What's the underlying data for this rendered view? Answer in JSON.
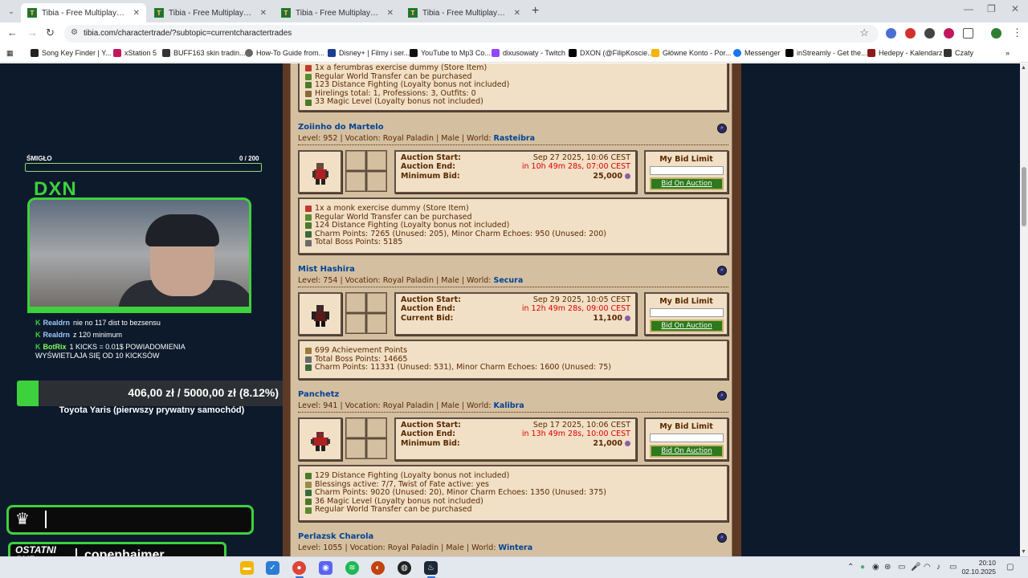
{
  "tabs": [
    {
      "title": "Tibia - Free Multiplayer Online",
      "active": true
    },
    {
      "title": "Tibia - Free Multiplayer Online",
      "active": false
    },
    {
      "title": "Tibia - Free Multiplayer Online",
      "active": false
    },
    {
      "title": "Tibia - Free Multiplayer Online",
      "active": false
    }
  ],
  "browser": {
    "url": "tibia.com/charactertrade/?subtopic=currentcharactertrades",
    "new_tab": "+"
  },
  "bookmarks": [
    {
      "label": "Song Key Finder | Y...",
      "color": "#222"
    },
    {
      "label": "xStation 5",
      "color": "#c2185b"
    },
    {
      "label": "BUFF163 skin tradin...",
      "color": "#333"
    },
    {
      "label": "How-To Guide from...",
      "color": "#666"
    },
    {
      "label": "Disney+ | Filmy i ser...",
      "color": "#1a3d8f"
    },
    {
      "label": "YouTube to Mp3 Co...",
      "color": "#111"
    },
    {
      "label": "dixusowaty - Twitch",
      "color": "#9146ff"
    },
    {
      "label": "DXON (@FilipKoscie...",
      "color": "#000"
    },
    {
      "label": "Główne Konto - Por...",
      "color": "#f4b400"
    },
    {
      "label": "Messenger",
      "color": "#1877f2"
    },
    {
      "label": "inStreamly - Get the...",
      "color": "#000"
    },
    {
      "label": "Hedepy - Kalendarz",
      "color": "#8b1a1a"
    },
    {
      "label": "Czaty",
      "color": "#333"
    }
  ],
  "stream": {
    "smiglo_label": "ŚMIGŁO",
    "smiglo_count": "0 / 200",
    "brand": "DXN",
    "chat": [
      {
        "user": "Realdrn",
        "msg": "nie no 117 dist to bezsensu",
        "style": "u1"
      },
      {
        "user": "Realdrn",
        "msg": "z 120 minimum",
        "style": "u1"
      },
      {
        "user": "BotRix",
        "msg": "1 KICKS = 0.01$ POWIADOMIENIA WYŚWIETLAJA SIĘ OD 10 KICKSÓW",
        "style": "u2"
      }
    ],
    "chat_icon": "K",
    "goal_text": "406,00 zł / 5000,00 zł (8.12%)",
    "goal_fraction": 0.0812,
    "goal_title": "Toyota Yaris (pierwszy prywatny samochód)",
    "last_sub_label": "OSTATNI SUB",
    "last_sub_name": "copenhaimer"
  },
  "top_partial_lines": [
    {
      "text": "1x a ferumbras exercise dummy (Store Item)",
      "icon": "#c0392b"
    },
    {
      "text": "Regular World Transfer can be purchased",
      "icon": "#5c8a2e"
    },
    {
      "text": "123 Distance Fighting (Loyalty bonus not included)",
      "icon": "#4a7a2a"
    },
    {
      "text": "Hirelings total: 1, Professions: 3, Outfits: 0",
      "icon": "#8a6a3a"
    },
    {
      "text": "33 Magic Level (Loyalty bonus not included)",
      "icon": "#4a7a2a"
    }
  ],
  "labels": {
    "auction_start": "Auction Start:",
    "auction_end": "Auction End:",
    "my_bid_limit": "My Bid Limit",
    "bid_button": "Bid On Auction"
  },
  "auctions": [
    {
      "name": "Zoiinho do Martelo",
      "info": "Level: 952 | Vocation: Royal Paladin | Male | World: ",
      "world": "Rasteibra",
      "start": "Sep 27 2025, 10:06 CEST",
      "end": "in 10h 49m 28s, 07:00 CEST",
      "bid_label": "Minimum Bid:",
      "bid": "25,000",
      "lines": [
        {
          "text": "1x a monk exercise dummy (Store Item)",
          "icon": "#c0392b"
        },
        {
          "text": "Regular World Transfer can be purchased",
          "icon": "#5c8a2e"
        },
        {
          "text": "124 Distance Fighting (Loyalty bonus not included)",
          "icon": "#4a7a2a"
        },
        {
          "text": "Charm Points: 7265 (Unused: 205), Minor Charm Echoes: 950 (Unused: 200)",
          "icon": "#3a6a3a"
        },
        {
          "text": "Total Boss Points: 5185",
          "icon": "#6a6a6a"
        }
      ]
    },
    {
      "name": "Mist Hashira",
      "info": "Level: 754 | Vocation: Royal Paladin | Male | World: ",
      "world": "Secura",
      "start": "Sep 29 2025, 10:05 CEST",
      "end": "in 12h 49m 28s, 09:00 CEST",
      "bid_label": "Current Bid:",
      "bid": "11,100",
      "lines": [
        {
          "text": "699 Achievement Points",
          "icon": "#9a7a3a"
        },
        {
          "text": "Total Boss Points: 14665",
          "icon": "#6a6a6a"
        },
        {
          "text": "Charm Points: 11331 (Unused: 531), Minor Charm Echoes: 1600 (Unused: 75)",
          "icon": "#3a6a3a"
        }
      ]
    },
    {
      "name": "Panchetz",
      "info": "Level: 941 | Vocation: Royal Paladin | Male | World: ",
      "world": "Kalibra",
      "start": "Sep 17 2025, 10:06 CEST",
      "end": "in 13h 49m 28s, 10:00 CEST",
      "bid_label": "Minimum Bid:",
      "bid": "21,000",
      "lines": [
        {
          "text": "129 Distance Fighting (Loyalty bonus not included)",
          "icon": "#4a7a2a"
        },
        {
          "text": "Blessings active: 7/7, Twist of Fate active: yes",
          "icon": "#9a8a4a"
        },
        {
          "text": "Charm Points: 9020 (Unused: 20), Minor Charm Echoes: 1350 (Unused: 375)",
          "icon": "#3a6a3a"
        },
        {
          "text": "36 Magic Level (Loyalty bonus not included)",
          "icon": "#4a7a2a"
        },
        {
          "text": "Regular World Transfer can be purchased",
          "icon": "#5c8a2e"
        }
      ]
    }
  ],
  "partial_auction": {
    "name": "Perlazsk Charola",
    "info": "Level: 1055 | Vocation: Royal Paladin | Male | World: ",
    "world": "Wintera"
  },
  "taskbar": {
    "time": "20:10",
    "date": "02.10.2025"
  }
}
